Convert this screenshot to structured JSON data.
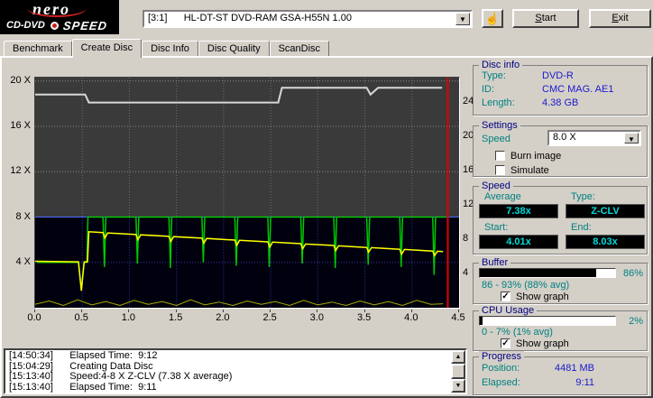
{
  "icons": {
    "dropdown_arrow": "▼",
    "scroll_up": "▲",
    "scroll_down": "▼",
    "hand": "☝"
  },
  "header": {
    "logo": {
      "name": "nero",
      "type": "CD-DVD",
      "speed": "SPEED"
    },
    "drive_combo": "[3:1]      HL-DT-ST DVD-RAM GSA-H55N 1.00",
    "start_label": "Start",
    "exit_label": "Exit"
  },
  "tabs": [
    {
      "label": "Benchmark",
      "active": false
    },
    {
      "label": "Create Disc",
      "active": true
    },
    {
      "label": "Disc Info",
      "active": false
    },
    {
      "label": "Disc Quality",
      "active": false
    },
    {
      "label": "ScanDisc",
      "active": false
    }
  ],
  "chart_data": {
    "type": "line",
    "x_max": 4.5,
    "left_max": 20.3,
    "right_max": 26.8,
    "x_ticks": [
      "0.0",
      "0.5",
      "1.0",
      "1.5",
      "2.0",
      "2.5",
      "3.0",
      "3.5",
      "4.0",
      "4.5"
    ],
    "left_ticks": [
      {
        "v": 20,
        "label": "20 X"
      },
      {
        "v": 16,
        "label": "16 X"
      },
      {
        "v": 12,
        "label": "12 X"
      },
      {
        "v": 8,
        "label": "8 X"
      },
      {
        "v": 4,
        "label": "4 X"
      }
    ],
    "right_ticks": [
      {
        "v": 24,
        "label": "24"
      },
      {
        "v": 20,
        "label": "20"
      },
      {
        "v": 16,
        "label": "16"
      },
      {
        "v": 12,
        "label": "12"
      },
      {
        "v": 8,
        "label": "8"
      },
      {
        "v": 4,
        "label": "4"
      }
    ],
    "grid_x": [
      0.5,
      1.0,
      1.5,
      2.0,
      2.5,
      3.0,
      3.5,
      4.0
    ],
    "grid_y": [
      4,
      12,
      16,
      20
    ],
    "highlight_y": 8,
    "end_marker_x": 4.38,
    "series": [
      {
        "name": "buffer-level",
        "color": "#d8d8d8",
        "width": 2,
        "points": [
          [
            0,
            18.8
          ],
          [
            0.53,
            18.8
          ],
          [
            0.57,
            18.1
          ],
          [
            2.58,
            18.1
          ],
          [
            2.62,
            19.4
          ],
          [
            3.52,
            19.4
          ],
          [
            3.56,
            18.8
          ],
          [
            3.64,
            19.4
          ],
          [
            4.32,
            19.4
          ]
        ]
      },
      {
        "name": "write-speed",
        "color": "#00c800",
        "width": 1.5,
        "points": [
          [
            0.02,
            4.0
          ],
          [
            0.46,
            4.0
          ],
          [
            0.49,
            1.6
          ],
          [
            0.52,
            4.0
          ],
          [
            0.55,
            4.0
          ],
          [
            0.56,
            8.0
          ],
          [
            0.72,
            8
          ],
          [
            0.735,
            3.6
          ],
          [
            0.75,
            8
          ],
          [
            1.07,
            8
          ],
          [
            1.085,
            3.9
          ],
          [
            1.1,
            8
          ],
          [
            1.42,
            8
          ],
          [
            1.435,
            3.5
          ],
          [
            1.45,
            8
          ],
          [
            1.77,
            8
          ],
          [
            1.785,
            4.0
          ],
          [
            1.8,
            8
          ],
          [
            2.12,
            8
          ],
          [
            2.135,
            3.7
          ],
          [
            2.15,
            8
          ],
          [
            2.47,
            8
          ],
          [
            2.485,
            3.6
          ],
          [
            2.5,
            8
          ],
          [
            2.82,
            8
          ],
          [
            2.835,
            3.9
          ],
          [
            2.85,
            8
          ],
          [
            3.17,
            8
          ],
          [
            3.185,
            3.5
          ],
          [
            3.2,
            8
          ],
          [
            3.52,
            8
          ],
          [
            3.535,
            3.8
          ],
          [
            3.55,
            8
          ],
          [
            3.87,
            8
          ],
          [
            3.885,
            3.6
          ],
          [
            3.9,
            8
          ],
          [
            4.22,
            8
          ],
          [
            4.235,
            2.9
          ],
          [
            4.25,
            8
          ],
          [
            4.36,
            8
          ]
        ]
      },
      {
        "name": "rotation-speed",
        "color": "#ffff00",
        "width": 1.5,
        "points": [
          [
            0,
            4.1
          ],
          [
            0.46,
            4.05
          ],
          [
            0.49,
            1.5
          ],
          [
            0.52,
            4.05
          ],
          [
            0.555,
            4.05
          ],
          [
            0.57,
            6.7
          ],
          [
            0.72,
            6.63
          ],
          [
            0.74,
            6.15
          ],
          [
            0.77,
            6.6
          ],
          [
            1.07,
            6.46
          ],
          [
            1.09,
            6.0
          ],
          [
            1.12,
            6.43
          ],
          [
            1.42,
            6.3
          ],
          [
            1.44,
            5.85
          ],
          [
            1.47,
            6.27
          ],
          [
            1.77,
            6.14
          ],
          [
            1.79,
            5.7
          ],
          [
            1.82,
            6.11
          ],
          [
            2.12,
            5.97
          ],
          [
            2.14,
            5.5
          ],
          [
            2.17,
            5.95
          ],
          [
            2.47,
            5.81
          ],
          [
            2.49,
            5.35
          ],
          [
            2.52,
            5.79
          ],
          [
            2.82,
            5.65
          ],
          [
            2.84,
            5.2
          ],
          [
            2.87,
            5.62
          ],
          [
            3.17,
            5.49
          ],
          [
            3.19,
            5.05
          ],
          [
            3.22,
            5.46
          ],
          [
            3.52,
            5.32
          ],
          [
            3.54,
            4.9
          ],
          [
            3.57,
            5.3
          ],
          [
            3.87,
            5.16
          ],
          [
            3.89,
            4.72
          ],
          [
            3.92,
            5.14
          ],
          [
            4.22,
            5.0
          ],
          [
            4.24,
            4.6
          ],
          [
            4.27,
            4.98
          ],
          [
            4.33,
            4.95
          ]
        ]
      },
      {
        "name": "cpu-usage",
        "color": "#a8a800",
        "width": 1,
        "points": [
          [
            0,
            0.3
          ],
          [
            0.15,
            0.6
          ],
          [
            0.3,
            0.2
          ],
          [
            0.45,
            0.7
          ],
          [
            0.6,
            0.25
          ],
          [
            0.75,
            0.55
          ],
          [
            0.9,
            0.2
          ],
          [
            1.05,
            0.65
          ],
          [
            1.2,
            0.3
          ],
          [
            1.35,
            0.55
          ],
          [
            1.5,
            0.2
          ],
          [
            1.65,
            0.7
          ],
          [
            1.8,
            0.25
          ],
          [
            1.95,
            0.5
          ],
          [
            2.1,
            0.2
          ],
          [
            2.25,
            0.6
          ],
          [
            2.4,
            0.3
          ],
          [
            2.55,
            0.55
          ],
          [
            2.7,
            0.2
          ],
          [
            2.85,
            0.65
          ],
          [
            3.0,
            0.25
          ],
          [
            3.15,
            0.5
          ],
          [
            3.3,
            0.2
          ],
          [
            3.45,
            0.6
          ],
          [
            3.6,
            0.25
          ],
          [
            3.75,
            0.55
          ],
          [
            3.9,
            0.2
          ],
          [
            4.05,
            0.65
          ],
          [
            4.2,
            0.3
          ],
          [
            4.33,
            0.35
          ]
        ]
      }
    ]
  },
  "disc_info": {
    "title": "Disc info",
    "type_label": "Type:",
    "type_value": "DVD-R",
    "id_label": "ID:",
    "id_value": "CMC MAG. AE1",
    "length_label": "Length:",
    "length_value": "4.38 GB"
  },
  "settings": {
    "title": "Settings",
    "speed_label": "Speed",
    "speed_value": "8.0 X",
    "burn_image_label": "Burn image",
    "burn_image_glyph": "",
    "simulate_label": "Simulate",
    "simulate_glyph": ""
  },
  "speed": {
    "title": "Speed",
    "average_label": "Average",
    "average_value": "7.38x",
    "type_label": "Type:",
    "type_value": "Z-CLV",
    "start_label": "Start:",
    "start_value": "4.01x",
    "end_label": "End:",
    "end_value": "8.03x"
  },
  "buffer": {
    "title": "Buffer",
    "percent": "86%",
    "fill_pct": 86,
    "range": "86 - 93% (88% avg)",
    "show_graph_label": "Show graph",
    "show_graph_glyph": "✓"
  },
  "cpu": {
    "title": "CPU Usage",
    "percent": "2%",
    "fill_pct": 2,
    "range": "0 - 7% (1% avg)",
    "show_graph_label": "Show graph",
    "show_graph_glyph": "✓"
  },
  "progress": {
    "title": "Progress",
    "position_label": "Position:",
    "position_value": "4481 MB",
    "elapsed_label": "Elapsed:",
    "elapsed_value": "9:11"
  },
  "log": {
    "lines": [
      "[14:50:34]      Elapsed Time:  9:12",
      "[15:04:29]      Creating Data Disc",
      "[15:13:40]      Speed:4-8 X Z-CLV (7.38 X average)",
      "[15:13:40]      Elapsed Time:  9:11"
    ]
  }
}
